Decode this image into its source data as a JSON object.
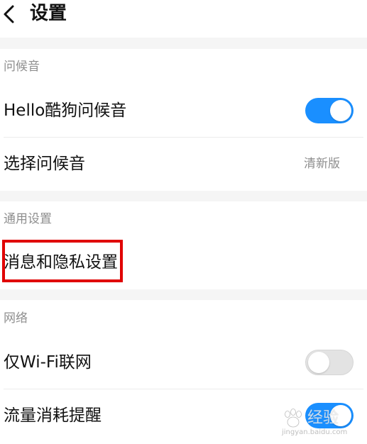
{
  "header": {
    "title": "设置",
    "back_icon": "chevron-left-icon"
  },
  "sections": {
    "greeting": {
      "label": "问候音",
      "items": [
        {
          "label": "Hello酷狗问候音",
          "toggle": true
        },
        {
          "label": "选择问候音",
          "value": "清新版"
        }
      ]
    },
    "general": {
      "label": "通用设置",
      "items": [
        {
          "label": "消息和隐私设置"
        }
      ]
    },
    "network": {
      "label": "网络",
      "items": [
        {
          "label": "仅Wi-Fi联网",
          "toggle": false
        },
        {
          "label": "流量消耗提醒",
          "toggle": true
        }
      ]
    }
  },
  "colors": {
    "accent": "#1a8fff",
    "toggle_off": "#e3e3e3",
    "highlight": "#e00000",
    "section_bg": "#f5f5f5",
    "secondary_text": "#8e8e8e"
  },
  "watermark": {
    "text": "经验",
    "subtext": "jingyan.baidu.com",
    "logo_icon": "baidu-paw-logo-icon"
  }
}
